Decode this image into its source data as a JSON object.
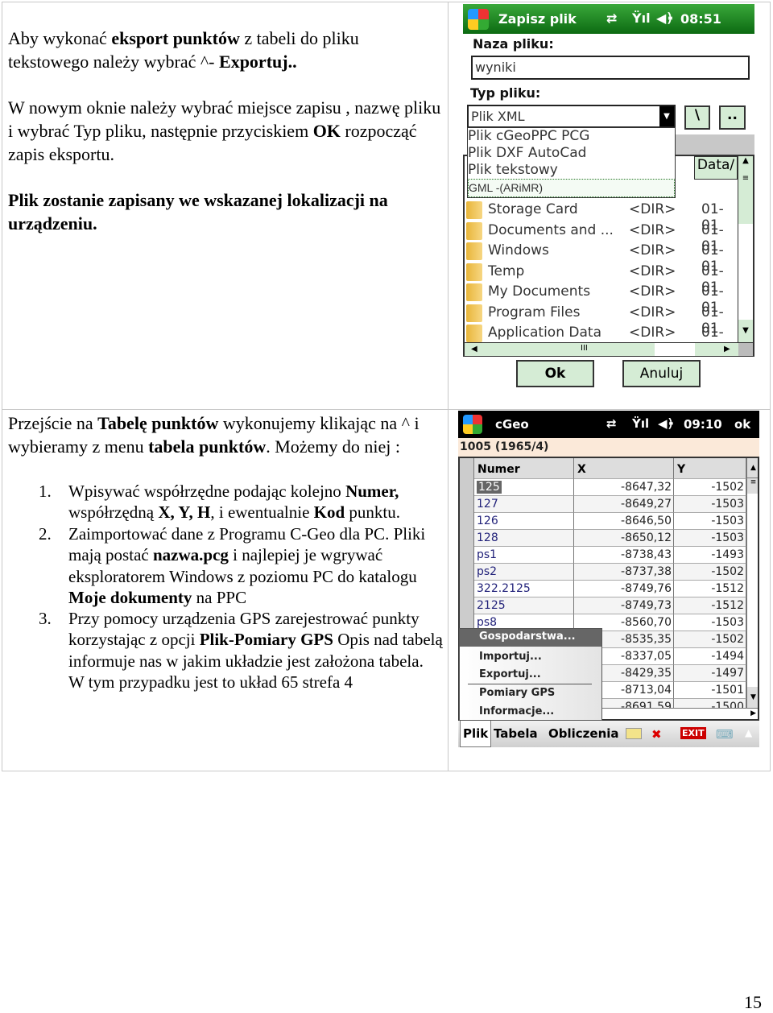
{
  "text": {
    "p1": [
      {
        "t": "Aby wykonać "
      },
      {
        "t": "eksport punktów",
        "b": 1
      },
      {
        "t": " z tabeli do pliku tekstowego należy wybrać ^- "
      },
      {
        "t": "Exportuj..",
        "b": 1
      }
    ],
    "p2": [
      {
        "t": "W nowym oknie należy wybrać miejsce zapisu , nazwę pliku i wybrać Typ pliku, następnie przyciskiem "
      },
      {
        "t": "OK",
        "b": 1
      },
      {
        "t": " rozpocząć zapis eksportu."
      }
    ],
    "p3": [
      {
        "t": "Plik zostanie zapisany we wskazanej lokalizacji na urządzeniu.",
        "b": 1
      }
    ],
    "p4": [
      {
        "t": "Przejście na "
      },
      {
        "t": "Tabelę punktów",
        "b": 1
      },
      {
        "t": " wykonujemy klikając na ^ i wybieramy z menu "
      },
      {
        "t": "tabela punktów",
        "b": 1
      },
      {
        "t": ". Możemy do niej :"
      }
    ],
    "list": [
      {
        "n": "1.",
        "parts": [
          {
            "t": "Wpisywać współrzędne podając kolejno "
          },
          {
            "t": "Numer,",
            "b": 1
          },
          {
            "t": " współrzędną  "
          },
          {
            "t": "X, Y, H",
            "b": 1
          },
          {
            "t": ", i ewentualnie "
          },
          {
            "t": "Kod",
            "b": 1
          },
          {
            "t": " punktu."
          }
        ]
      },
      {
        "n": "2.",
        "parts": [
          {
            "t": "Zaimportować dane z Programu C-Geo dla PC. Pliki mają postać "
          },
          {
            "t": "nazwa.pcg",
            "b": 1
          },
          {
            "t": " i najlepiej je wgrywać eksploratorem Windows z poziomu PC do katalogu "
          },
          {
            "t": "Moje dokumenty",
            "b": 1
          },
          {
            "t": " na  PPC"
          }
        ]
      },
      {
        "n": "3.",
        "parts": [
          {
            "t": "Przy pomocy urządzenia GPS zarejestrować punkty korzystając z opcji "
          },
          {
            "t": "Plik-Pomiary GPS",
            "b": 1
          },
          {
            "t": " Opis nad tabelą informuje nas w jakim układzie jest założona tabela. W tym przypadku jest to układ 65 strefa 4"
          }
        ]
      }
    ],
    "page_number": "15"
  },
  "save_dialog": {
    "title": "Zapisz plik",
    "time": "08:51",
    "filename_label": "Naza pliku:",
    "filename_value": "wyniki",
    "filetype_label": "Typ pliku:",
    "filetype_selected": "Plik XML",
    "filetype_options": [
      "Plik cGeoPPC PCG",
      "Plik DXF AutoCad",
      "Plik tekstowy",
      "GML -(ARiMR)"
    ],
    "root_button": "\\",
    "up_button": "..",
    "date_header": "Data/",
    "folders": [
      {
        "name": "Storage Card",
        "type": "<DIR>",
        "date": "01-01"
      },
      {
        "name": "Documents and ...",
        "type": "<DIR>",
        "date": "01-01"
      },
      {
        "name": "Windows",
        "type": "<DIR>",
        "date": "01-01"
      },
      {
        "name": "Temp",
        "type": "<DIR>",
        "date": "01-01"
      },
      {
        "name": "My Documents",
        "type": "<DIR>",
        "date": "01-01"
      },
      {
        "name": "Program Files",
        "type": "<DIR>",
        "date": "01-01"
      },
      {
        "name": "Application Data",
        "type": "<DIR>",
        "date": "01-01"
      }
    ],
    "ok": "Ok",
    "cancel": "Anuluj",
    "accent": "#1e8a24",
    "button_bg": "#d5ecd5"
  },
  "cgeo": {
    "title": "cGeo",
    "time": "09:10",
    "ok": "ok",
    "subtitle": "1005 (1965/4)",
    "headers": [
      "Numer",
      "X",
      "Y"
    ],
    "rows": [
      [
        "125",
        "-8647,32",
        "-1502"
      ],
      [
        "127",
        "-8649,27",
        "-1503"
      ],
      [
        "126",
        "-8646,50",
        "-1503"
      ],
      [
        "128",
        "-8650,12",
        "-1503"
      ],
      [
        "ps1",
        "-8738,43",
        "-1493"
      ],
      [
        "ps2",
        "-8737,38",
        "-1502"
      ],
      [
        "322.2125",
        "-8749,76",
        "-1512"
      ],
      [
        "2125",
        "-8749,73",
        "-1512"
      ],
      [
        "ps8",
        "-8560,70",
        "-1503"
      ],
      [
        "",
        "-8535,35",
        "-1502"
      ],
      [
        "",
        "-8337,05",
        "-1494"
      ],
      [
        "",
        "-8429,35",
        "-1497"
      ],
      [
        "",
        "-8713,04",
        "-1501"
      ],
      [
        "",
        "-8691,59",
        "-1500"
      ]
    ],
    "menu": [
      "Gospodarstwa...",
      "Importuj...",
      "Exportuj...",
      "Pomiary GPS",
      "Informacje..."
    ],
    "menubar": [
      "Plik",
      "Tabela",
      "Obliczenia"
    ],
    "exit_label": "EXIT"
  }
}
